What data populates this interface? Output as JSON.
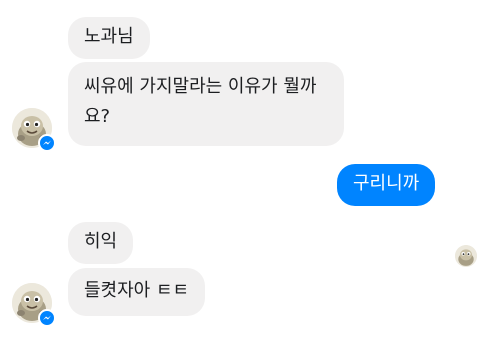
{
  "messages": [
    {
      "sender": "other",
      "text": "노과님"
    },
    {
      "sender": "other",
      "text": "씨유에 가지말라는 이유가 뭘까요?"
    },
    {
      "sender": "me",
      "text": "구리니까"
    },
    {
      "sender": "other",
      "text": "히익"
    },
    {
      "sender": "other",
      "text": "들켯자아 ㅌㅌ"
    }
  ],
  "colors": {
    "incoming_bubble": "#f1f0f0",
    "outgoing_bubble": "#0084ff",
    "messenger_badge": "#0084ff"
  },
  "icons": {
    "avatar": "cartoon-animal-avatar",
    "badge": "messenger-icon",
    "read_receipt": "read-receipt-avatar"
  }
}
